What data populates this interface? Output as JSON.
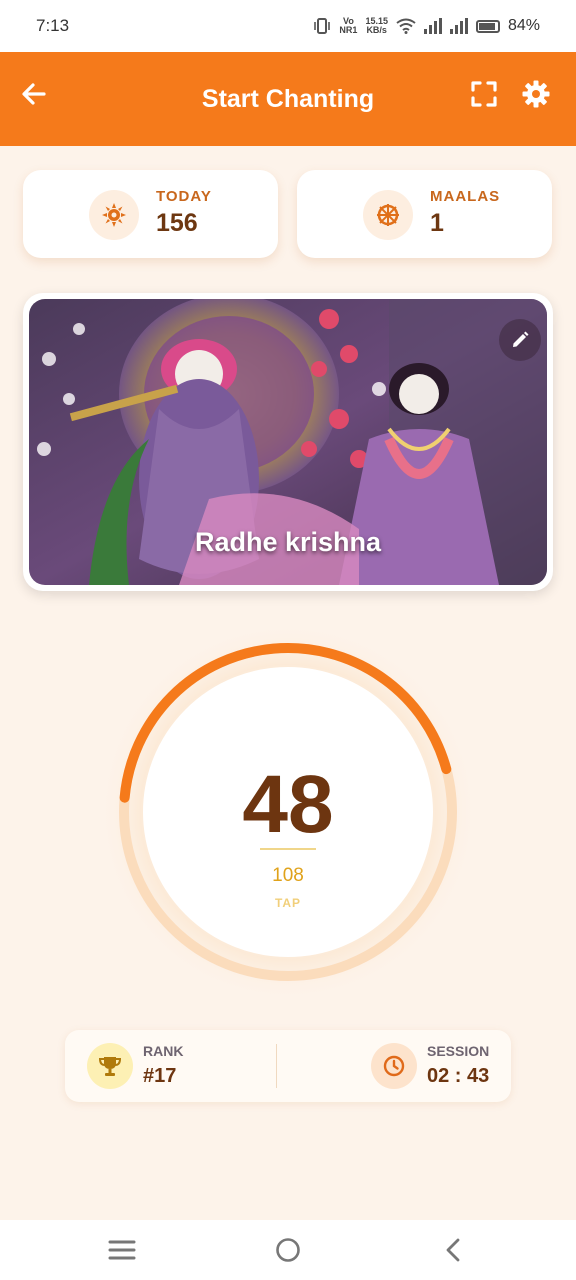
{
  "status_bar": {
    "time": "7:13",
    "network_label_top": "Vo",
    "network_label_bottom": "NR1",
    "speed_top": "15.15",
    "speed_bottom": "KB/s",
    "battery": "84%"
  },
  "app_bar": {
    "title": "Start Chanting",
    "back_icon": "arrow-left-icon",
    "fullscreen_icon": "fullscreen-icon",
    "settings_icon": "gear-icon"
  },
  "stats": {
    "today": {
      "label": "TODAY",
      "value": "156",
      "icon": "sun-icon"
    },
    "maalas": {
      "label": "MAALAS",
      "value": "1",
      "icon": "dharma-wheel-icon"
    }
  },
  "deity": {
    "caption": "Radhe krishna",
    "edit_icon": "pencil-icon"
  },
  "counter": {
    "count": "48",
    "target": "108",
    "tap_label": "TAP",
    "progress_fraction": 0.444
  },
  "info": {
    "rank": {
      "label": "RANK",
      "value": "#17",
      "icon": "trophy-icon"
    },
    "session": {
      "label": "SESSION",
      "value": "02 : 43",
      "icon": "clock-icon"
    }
  },
  "nav": {
    "recents_icon": "menu-icon",
    "home_icon": "home-circle-icon",
    "back_icon": "chevron-left-icon"
  },
  "colors": {
    "accent": "#f57a1b",
    "brown": "#6d3510",
    "background": "#fdf3ea"
  }
}
